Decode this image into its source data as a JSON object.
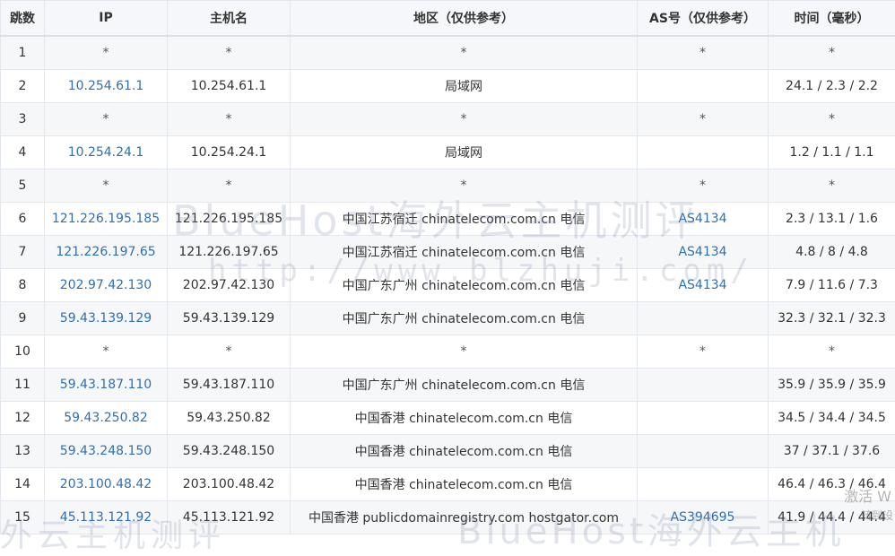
{
  "columns": {
    "hop": "跳数",
    "ip": "IP",
    "host": "主机名",
    "region": "地区（仅供参考）",
    "as": "AS号（仅供参考）",
    "time": "时间（毫秒）"
  },
  "rows": [
    {
      "hop": "1",
      "ip": "*",
      "host": "*",
      "region": "*",
      "as": "*",
      "time": "*"
    },
    {
      "hop": "2",
      "ip": "10.254.61.1",
      "host": "10.254.61.1",
      "region": "局域网",
      "as": "",
      "time": "24.1 / 2.3 / 2.2"
    },
    {
      "hop": "3",
      "ip": "*",
      "host": "*",
      "region": "*",
      "as": "*",
      "time": "*"
    },
    {
      "hop": "4",
      "ip": "10.254.24.1",
      "host": "10.254.24.1",
      "region": "局域网",
      "as": "",
      "time": "1.2 / 1.1 / 1.1"
    },
    {
      "hop": "5",
      "ip": "*",
      "host": "*",
      "region": "*",
      "as": "*",
      "time": "*"
    },
    {
      "hop": "6",
      "ip": "121.226.195.185",
      "host": "121.226.195.185",
      "region": "中国江苏宿迁 chinatelecom.com.cn 电信",
      "as": "AS4134",
      "time": "2.3 / 13.1 / 1.6"
    },
    {
      "hop": "7",
      "ip": "121.226.197.65",
      "host": "121.226.197.65",
      "region": "中国江苏宿迁 chinatelecom.com.cn 电信",
      "as": "AS4134",
      "time": "4.8 / 8 / 4.8"
    },
    {
      "hop": "8",
      "ip": "202.97.42.130",
      "host": "202.97.42.130",
      "region": "中国广东广州 chinatelecom.com.cn 电信",
      "as": "AS4134",
      "time": "7.9 / 11.6 / 7.3"
    },
    {
      "hop": "9",
      "ip": "59.43.139.129",
      "host": "59.43.139.129",
      "region": "中国广东广州 chinatelecom.com.cn 电信",
      "as": "",
      "time": "32.3 / 32.1 / 32.3"
    },
    {
      "hop": "10",
      "ip": "*",
      "host": "*",
      "region": "*",
      "as": "*",
      "time": "*"
    },
    {
      "hop": "11",
      "ip": "59.43.187.110",
      "host": "59.43.187.110",
      "region": "中国广东广州 chinatelecom.com.cn 电信",
      "as": "",
      "time": "35.9 / 35.9 / 35.9"
    },
    {
      "hop": "12",
      "ip": "59.43.250.82",
      "host": "59.43.250.82",
      "region": "中国香港 chinatelecom.com.cn 电信",
      "as": "",
      "time": "34.5 / 34.4 / 34.5"
    },
    {
      "hop": "13",
      "ip": "59.43.248.150",
      "host": "59.43.248.150",
      "region": "中国香港 chinatelecom.com.cn 电信",
      "as": "",
      "time": "37 / 37.1 / 37.6"
    },
    {
      "hop": "14",
      "ip": "203.100.48.42",
      "host": "203.100.48.42",
      "region": "中国香港 chinatelecom.com.cn 电信",
      "as": "",
      "time": "46.4 / 46.3 / 46.4"
    },
    {
      "hop": "15",
      "ip": "45.113.121.92",
      "host": "45.113.121.92",
      "region": "中国香港 publicdomainregistry.com hostgator.com",
      "as": "AS394695",
      "time": "41.9 / 44.4 / 44.4"
    }
  ],
  "watermark": {
    "main": "BlueHost海外云主机测评",
    "url": "http://www.blzhuji.com/",
    "bottom": "BlueHost海外云主机",
    "bottom_left": "外云主机测评"
  },
  "os_overlay": {
    "activate": "激活 W",
    "sub": "转到设"
  },
  "colors": {
    "link": "#2f6fb0",
    "header_bg": "#f5f7fa",
    "stripe_bg": "#f6f7f9",
    "border": "#e4e7ed"
  }
}
